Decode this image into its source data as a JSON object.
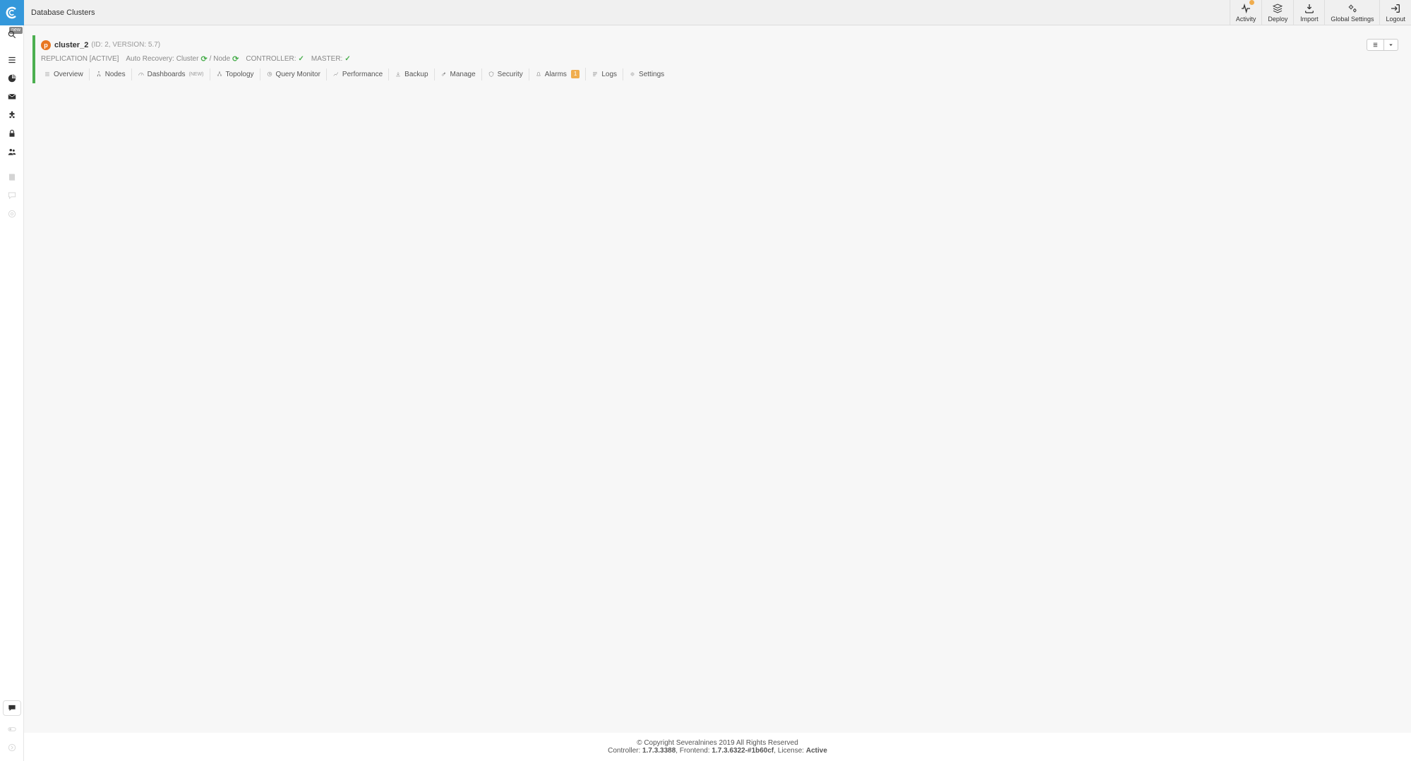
{
  "header": {
    "title": "Database Clusters",
    "nav": {
      "activity": "Activity",
      "deploy": "Deploy",
      "import": "Import",
      "global_settings": "Global Settings",
      "logout": "Logout"
    }
  },
  "sidebar": {
    "new_tag": "new"
  },
  "cluster": {
    "name": "cluster_2",
    "meta": "(ID: 2, VERSION: 5.7)",
    "status": {
      "replication": "REPLICATION [ACTIVE]",
      "auto_recovery_label": "Auto Recovery:",
      "auto_recovery_cluster": "Cluster",
      "auto_recovery_node": "/ Node",
      "controller_label": "CONTROLLER:",
      "master_label": "MASTER:"
    },
    "tabs": {
      "overview": "Overview",
      "nodes": "Nodes",
      "dashboards": "Dashboards",
      "dashboards_sup": "(NEW)",
      "topology": "Topology",
      "query_monitor": "Query Monitor",
      "performance": "Performance",
      "backup": "Backup",
      "manage": "Manage",
      "security": "Security",
      "alarms": "Alarms",
      "alarms_badge": "1",
      "logs": "Logs",
      "settings": "Settings"
    }
  },
  "footer": {
    "copyright": "© Copyright Severalnines 2019 All Rights Reserved",
    "controller_label": "Controller: ",
    "controller_ver": "1.7.3.3388",
    "frontend_label": ", Frontend: ",
    "frontend_ver": "1.7.3.6322-#1b60cf",
    "license_label": ", License: ",
    "license_val": "Active"
  }
}
